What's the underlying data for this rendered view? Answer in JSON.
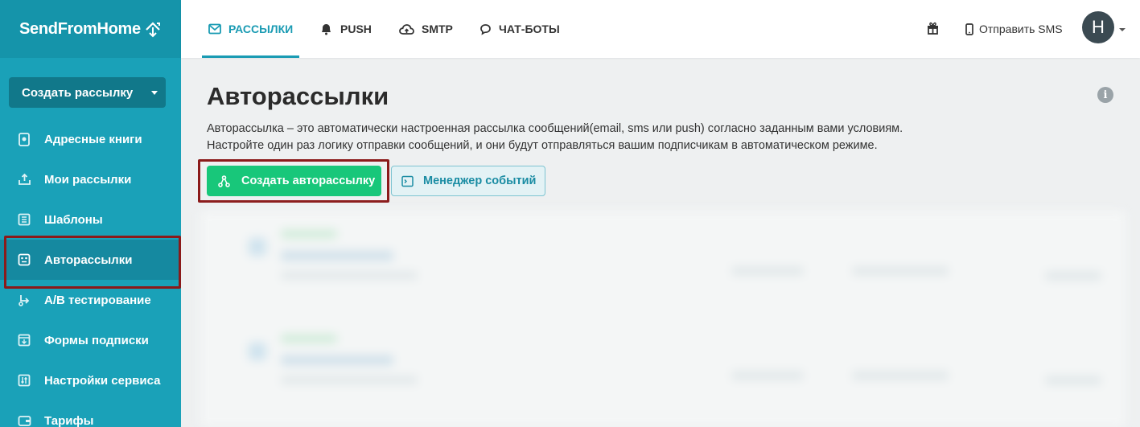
{
  "brand": {
    "name": "SendFromHome"
  },
  "sidebar": {
    "create_button": "Создать рассылку",
    "items": [
      {
        "label": "Адресные книги",
        "icon": "address-book-icon"
      },
      {
        "label": "Мои рассылки",
        "icon": "send-tray-icon"
      },
      {
        "label": "Шаблоны",
        "icon": "template-icon"
      },
      {
        "label": "Авторассылки",
        "icon": "automation-icon",
        "active": true
      },
      {
        "label": "А/В тестирование",
        "icon": "ab-test-icon"
      },
      {
        "label": "Формы подписки",
        "icon": "form-icon"
      },
      {
        "label": "Настройки сервиса",
        "icon": "settings-sliders-icon"
      },
      {
        "label": "Тарифы",
        "icon": "wallet-icon"
      }
    ]
  },
  "topbar": {
    "tabs": [
      {
        "label": "РАССЫЛКИ",
        "icon": "mail-icon",
        "active": true
      },
      {
        "label": "PUSH",
        "icon": "bell-icon"
      },
      {
        "label": "SMTP",
        "icon": "cloud-upload-icon"
      },
      {
        "label": "ЧАТ-БОТЫ",
        "icon": "chat-icon"
      }
    ],
    "send_sms": "Отправить SMS",
    "avatar_letter": "Н"
  },
  "main": {
    "title": "Авторассылки",
    "description_line1": "Авторассылка – это автоматически настроенная рассылка сообщений(email, sms или push) согласно заданным вами условиям.",
    "description_line2": "Настройте один раз логику отправки сообщений, и они будут отправляться вашим подписчикам в автоматическом режиме.",
    "create_auto_button": "Создать авторассылку",
    "event_manager_button": "Менеджер событий"
  },
  "colors": {
    "sidebar": "#1aa1b8",
    "accent": "#1a9bb3",
    "green": "#18c77a",
    "highlight": "#8b1a1a"
  }
}
